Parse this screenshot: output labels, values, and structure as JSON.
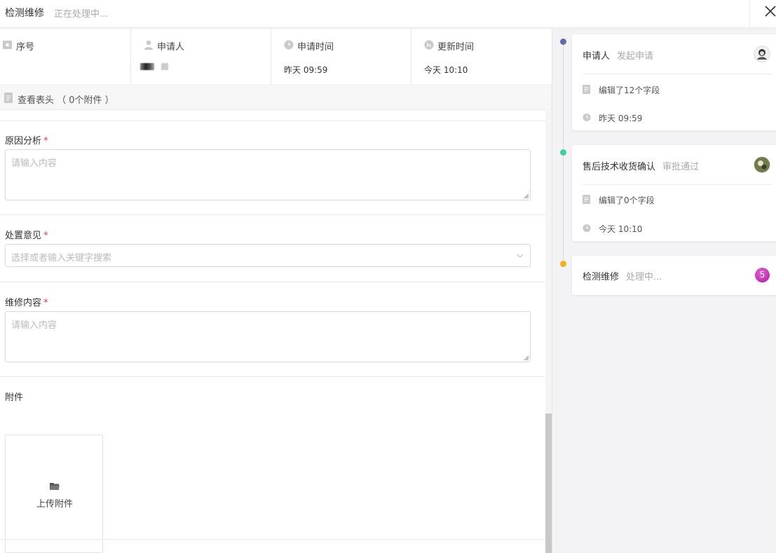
{
  "header": {
    "title": "检测维修",
    "status": "正在处理中..."
  },
  "info": {
    "serial_label": "序号",
    "applicant_label": "申请人",
    "apply_time_label": "申请时间",
    "apply_time_value": "昨天 09:59",
    "update_time_label": "更新时间",
    "update_time_value": "今天 10:10"
  },
  "form_header": {
    "text": "查看表头 （ 0个附件 ）"
  },
  "form": {
    "cause": {
      "label": "原因分析",
      "required": "*",
      "placeholder": "请输入内容"
    },
    "opinion": {
      "label": "处置意见",
      "required": "*",
      "placeholder": "选择或者输入关键字搜索"
    },
    "repair": {
      "label": "维修内容",
      "required": "*",
      "placeholder": "请输入内容"
    },
    "attachment": {
      "label": "附件",
      "upload_label": "上传附件"
    }
  },
  "timeline": [
    {
      "title": "申请人",
      "status": "发起申请",
      "edited": "编辑了12个字段",
      "time": "昨天 09:59",
      "dot_color": "#5a6fa8"
    },
    {
      "title": "售后技术收货确认",
      "status": "审批通过",
      "edited": "编辑了0个字段",
      "time": "今天 10:10",
      "dot_color": "#3ccfa2"
    },
    {
      "title": "检测维修",
      "status": "处理中...",
      "badge": "5",
      "dot_color": "#f2b11c"
    }
  ]
}
